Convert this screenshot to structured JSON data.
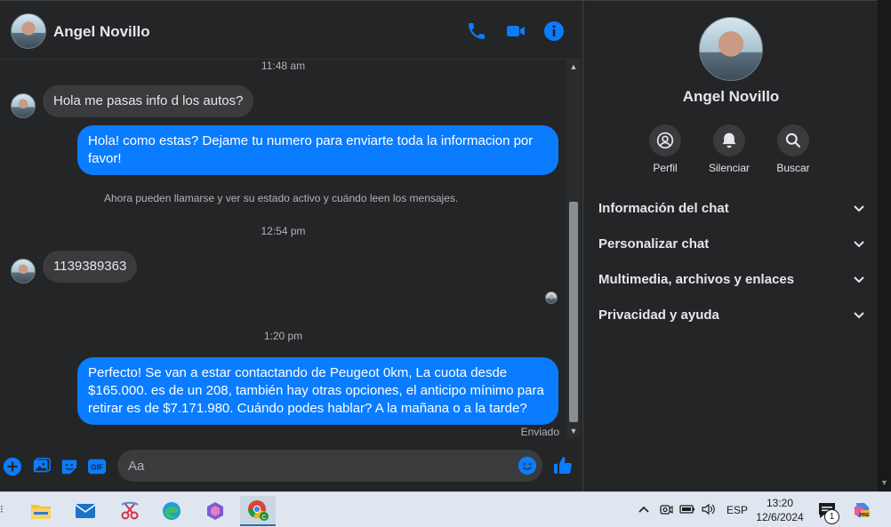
{
  "header": {
    "contact_name": "Angel Novillo"
  },
  "icons": {
    "call": "phone-icon",
    "video": "video-camera-icon",
    "info": "info-icon"
  },
  "messages": {
    "ts1": "11:48 am",
    "m1": "Hola me pasas info d los autos?",
    "m2": "Hola! como estas? Dejame tu numero para enviarte toda la informacion por favor!",
    "note": "Ahora pueden llamarse y ver su estado activo y cuándo leen los mensajes.",
    "ts2": "12:54 pm",
    "m3": "1139389363",
    "ts3": "1:20 pm",
    "m4": "Perfecto!  Se van a estar contactando de Peugeot 0km, La cuota desde $165.000. es de un 208, también hay otras opciones, el anticipo mínimo para retirar es de $7.171.980. Cuándo podes hablar? A la mañana o a la tarde?",
    "status": "Enviado"
  },
  "composer": {
    "placeholder": "Aa",
    "gif_label": "GIF"
  },
  "panel": {
    "name": "Angel Novillo",
    "actions": {
      "profile": "Perfil",
      "mute": "Silenciar",
      "search": "Buscar"
    },
    "sections": {
      "chat_info": "Información del chat",
      "customize": "Personalizar chat",
      "media": "Multimedia, archivos y enlaces",
      "privacy": "Privacidad y ayuda"
    }
  },
  "taskbar": {
    "tray_lang": "ESP",
    "time": "13:20",
    "date": "12/6/2024",
    "notif_count": "1",
    "chrome_badge": "C",
    "copilot_badge": "PRE"
  },
  "colors": {
    "accent": "#0a7cff",
    "panel_bg": "#242526",
    "bubble_in": "#3a3b3c"
  }
}
